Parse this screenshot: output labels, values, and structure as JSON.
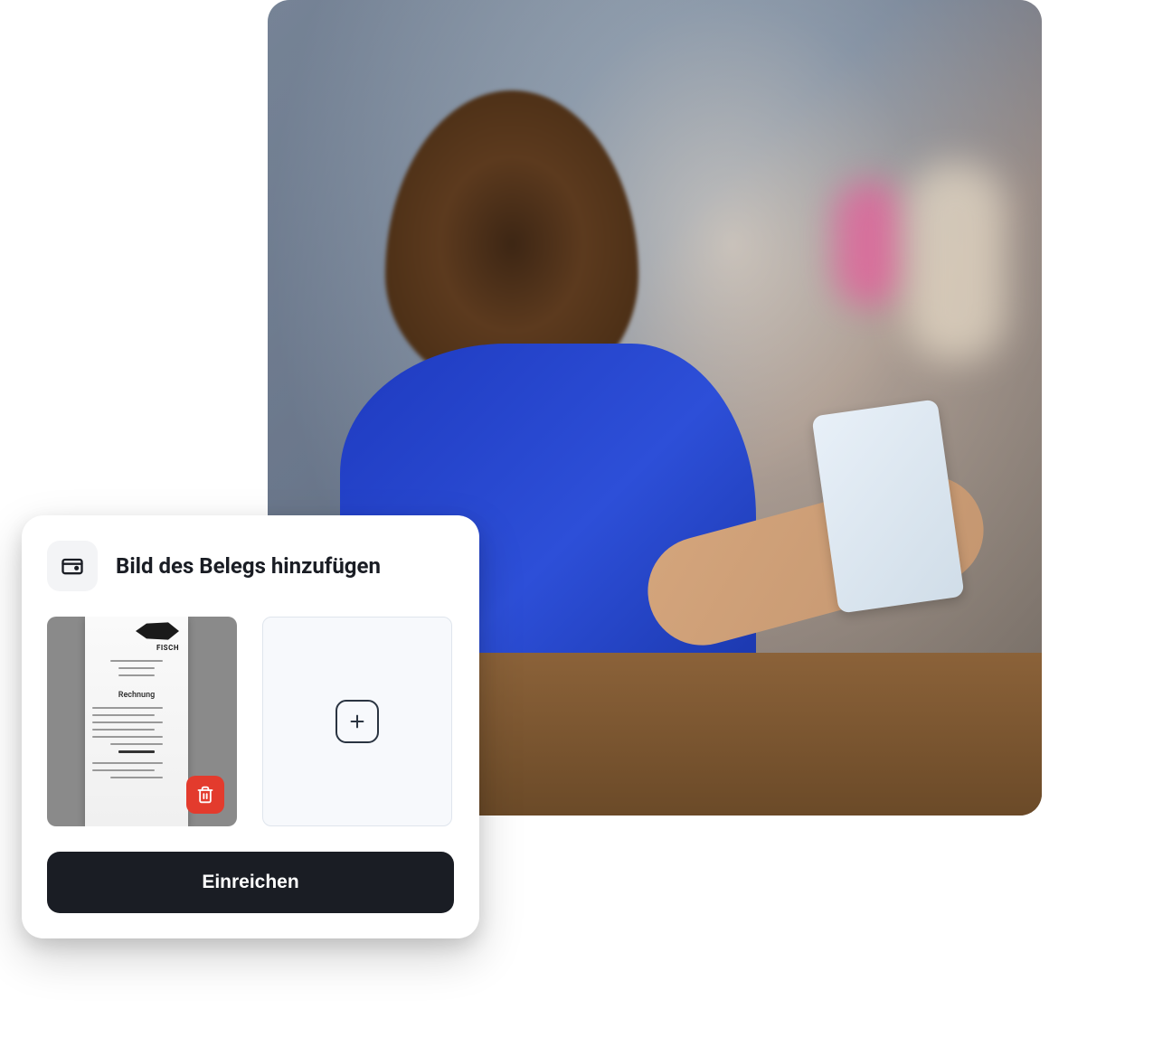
{
  "card": {
    "title": "Bild des Belegs hinzufügen",
    "submit_label": "Einreichen"
  },
  "icons": {
    "wallet": "wallet-icon",
    "delete": "trash-icon",
    "add": "plus-icon"
  },
  "receipt": {
    "vendor_label": "FISCH",
    "heading": "Rechnung"
  },
  "colors": {
    "accent_delete": "#e33b2d",
    "button_dark": "#1a1d24",
    "add_tile_bg": "#f7f9fc",
    "add_tile_border": "#dfe5ed"
  }
}
